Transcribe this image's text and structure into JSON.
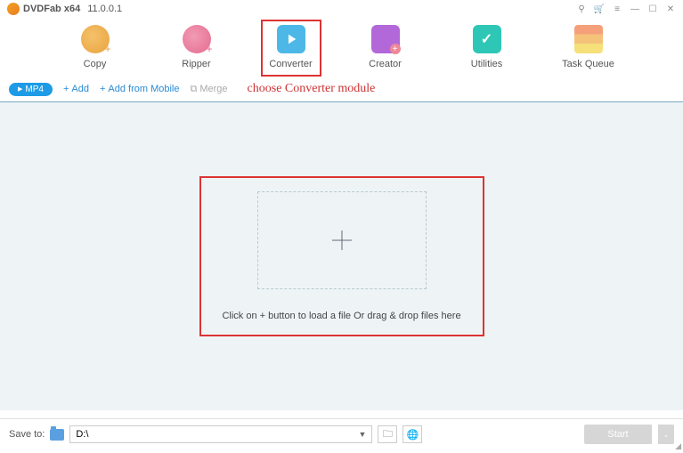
{
  "titlebar": {
    "app_name": "DVDFab x64",
    "version": "11.0.0.1"
  },
  "modules": {
    "copy": "Copy",
    "ripper": "Ripper",
    "converter": "Converter",
    "creator": "Creator",
    "utilities": "Utilities",
    "task_queue": "Task Queue"
  },
  "toolbar": {
    "format": "MP4",
    "add": "Add",
    "add_mobile": "Add from Mobile",
    "merge": "Merge"
  },
  "annotation": "choose Converter module",
  "drop": {
    "text": "Click on + button to load a file Or drag & drop files here"
  },
  "footer": {
    "save_to_label": "Save to:",
    "path": "D:\\",
    "start": "Start"
  }
}
